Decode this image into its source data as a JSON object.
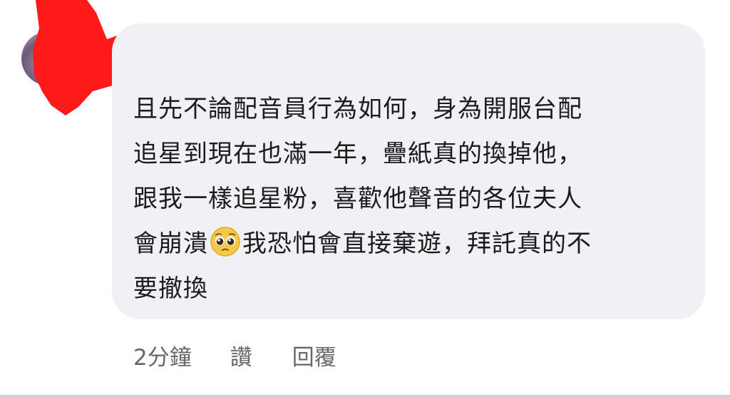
{
  "comment": {
    "line1": "且先不論配音員行為如何，身為開服台配",
    "line2": "追星到現在也滿一年，疊紙真的換掉他，",
    "line3": "跟我一樣追星粉，喜歡他聲音的各位夫人",
    "line4_before_emoji": "會崩潰",
    "emoji": "pleading-face-emoji",
    "line4_after_emoji": "我恐怕會直接棄遊，拜託真的不",
    "line5": "要撤換"
  },
  "actions": {
    "time": "2分鐘",
    "like_label": "讚",
    "reply_label": "回覆"
  },
  "colors": {
    "bubble_bg": "#f0f1f5",
    "text": "#1c1c1e",
    "meta_text": "#65676b",
    "redaction": "#ff1a1a"
  }
}
